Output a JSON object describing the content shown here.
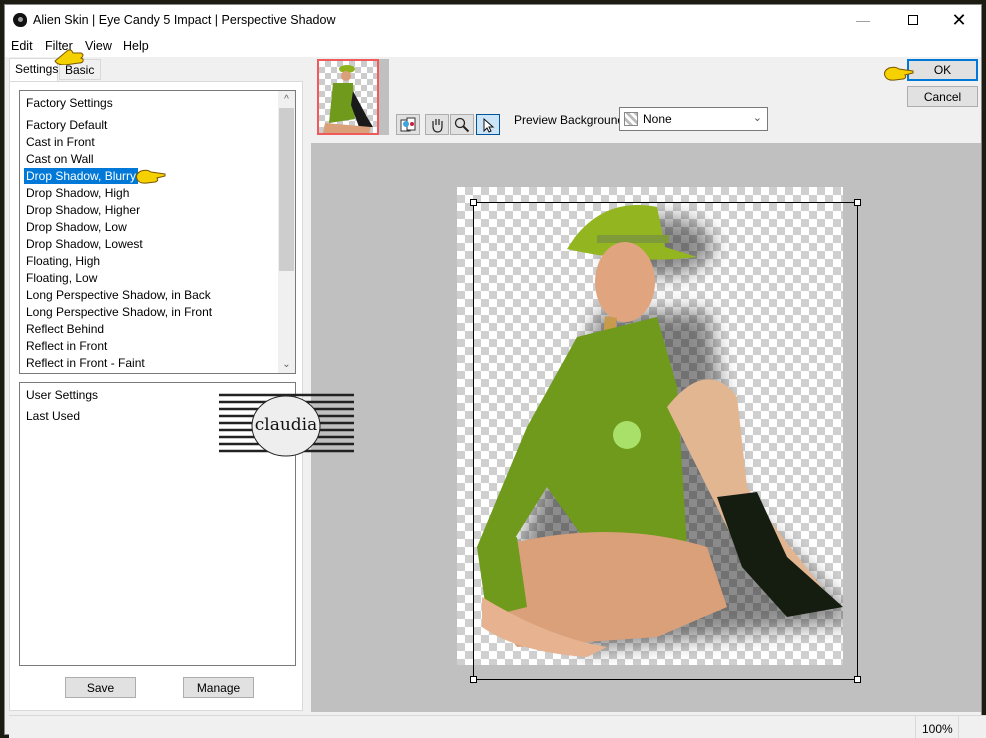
{
  "window": {
    "title": "Alien Skin | Eye Candy 5 Impact | Perspective Shadow",
    "controls": [
      "minimize",
      "maximize",
      "close"
    ]
  },
  "menu": [
    "Edit",
    "Filter",
    "View",
    "Help"
  ],
  "tabs": [
    {
      "label": "Settings",
      "active": true
    },
    {
      "label": "Basic",
      "active": false
    }
  ],
  "factory_settings": {
    "header": "Factory Settings",
    "items": [
      "Factory Default",
      "Cast in Front",
      "Cast on Wall",
      "Drop Shadow, Blurry",
      "Drop Shadow, High",
      "Drop Shadow, Higher",
      "Drop Shadow, Low",
      "Drop Shadow, Lowest",
      "Floating, High",
      "Floating, Low",
      "Long Perspective Shadow, in Back",
      "Long Perspective Shadow, in Front",
      "Reflect Behind",
      "Reflect in Front",
      "Reflect in Front - Faint"
    ],
    "selected": "Drop Shadow, Blurry"
  },
  "user_settings": {
    "header": "User Settings",
    "items": [
      "Last Used"
    ]
  },
  "buttons": {
    "save": "Save",
    "manage": "Manage",
    "ok": "OK",
    "cancel": "Cancel"
  },
  "toolbar": {
    "tools": [
      "preview-compare",
      "hand",
      "zoom",
      "selection-arrow"
    ],
    "active_tool": "selection-arrow"
  },
  "preview_background": {
    "label": "Preview Background:",
    "value": "None"
  },
  "watermark": "claudia",
  "status": {
    "zoom": "100%"
  },
  "colors": {
    "selection": "#0078d7",
    "thumbnail_border": "#ef5a5a",
    "preview_bg": "#c0c0c0"
  }
}
